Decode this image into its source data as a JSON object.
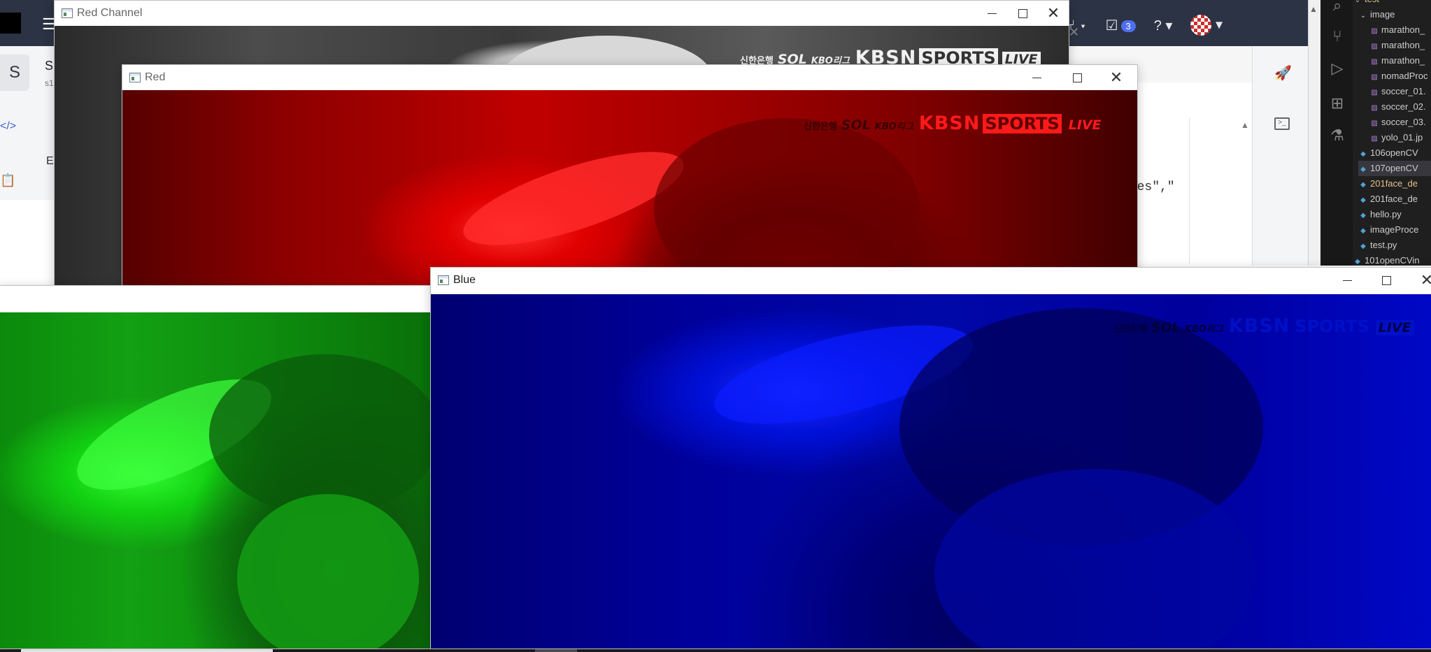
{
  "background_app": {
    "left_tile_letter": "S",
    "left_label": "S",
    "left_sub": "s1",
    "left_e_label": "E",
    "pr_badge_count": "3",
    "editor_code_fragment": "iles\",\"",
    "colors": {
      "topbar": "#2b3344",
      "accent": "#4f6ef0"
    }
  },
  "explorer": {
    "items": [
      {
        "label": "test",
        "type": "folder-open",
        "highlight": "yellow"
      },
      {
        "label": "image",
        "type": "folder-open"
      },
      {
        "label": "marathon_",
        "type": "image"
      },
      {
        "label": "marathon_",
        "type": "image"
      },
      {
        "label": "marathon_",
        "type": "image"
      },
      {
        "label": "nomadProc",
        "type": "image"
      },
      {
        "label": "soccer_01.",
        "type": "image"
      },
      {
        "label": "soccer_02.",
        "type": "image"
      },
      {
        "label": "soccer_03.",
        "type": "image"
      },
      {
        "label": "yolo_01.jp",
        "type": "image"
      },
      {
        "label": "106openCV",
        "type": "python"
      },
      {
        "label": "107openCV",
        "type": "python",
        "selected": true
      },
      {
        "label": "201face_de",
        "type": "python",
        "highlight": "yellow"
      },
      {
        "label": "201face_de",
        "type": "python"
      },
      {
        "label": "hello.py",
        "type": "python"
      },
      {
        "label": "imageProce",
        "type": "python"
      },
      {
        "label": "test.py",
        "type": "python"
      },
      {
        "label": "101openCVin",
        "type": "python"
      }
    ]
  },
  "windows": {
    "red_channel": {
      "title": "Red Channel",
      "image_desc_icon": "grayscale-channel-image"
    },
    "red": {
      "title": "Red",
      "channel_color": "#ff0000"
    },
    "green": {
      "title": "",
      "channel_color": "#00ff00"
    },
    "blue": {
      "title": "Blue",
      "channel_color": "#0000ff"
    }
  },
  "broadcast_logo": {
    "bank": "신한은행",
    "sol": "SOL",
    "league": "KBO리그",
    "network": "KBSN",
    "sports": "SPORTS",
    "live": "LIVE"
  }
}
